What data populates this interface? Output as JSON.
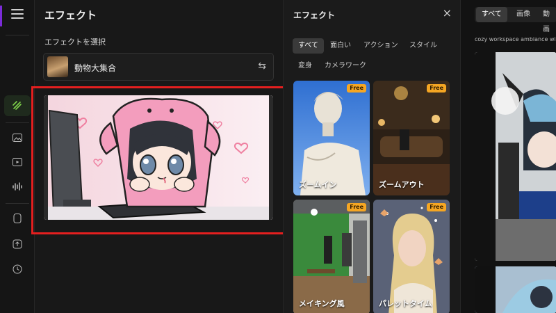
{
  "app": {
    "accent": "#7b2bd8",
    "highlight_color": "#e41f1f"
  },
  "rail": {
    "icons": [
      "menu-icon",
      "effects-icon",
      "image-icon",
      "video-icon",
      "audio-icon",
      "device-icon",
      "upload-icon",
      "history-icon"
    ],
    "active": "effects-icon"
  },
  "left_panel": {
    "title": "エフェクト",
    "select_label": "エフェクトを選択",
    "selected_effect": "動物大集合",
    "swap_icon": "⇆"
  },
  "effects_panel": {
    "title": "エフェクト",
    "close": "×",
    "tags": [
      {
        "label": "すべて",
        "active": true
      },
      {
        "label": "面白い",
        "active": false
      },
      {
        "label": "アクション",
        "active": false
      },
      {
        "label": "スタイル",
        "active": false
      },
      {
        "label": "変身",
        "active": false
      },
      {
        "label": "カメラワーク",
        "active": false
      }
    ],
    "cards": [
      {
        "label": "ズームイン",
        "badge": "Free"
      },
      {
        "label": "ズームアウト",
        "badge": "Free"
      },
      {
        "label": "メイキング風",
        "badge": "Free"
      },
      {
        "label": "パレットタイム",
        "badge": "Free"
      }
    ]
  },
  "right_panel": {
    "tabs": [
      {
        "label": "すべて",
        "active": true
      },
      {
        "label": "画像",
        "active": false
      },
      {
        "label": "動画",
        "active": false
      }
    ],
    "description": "cozy workspace ambiance wit"
  }
}
